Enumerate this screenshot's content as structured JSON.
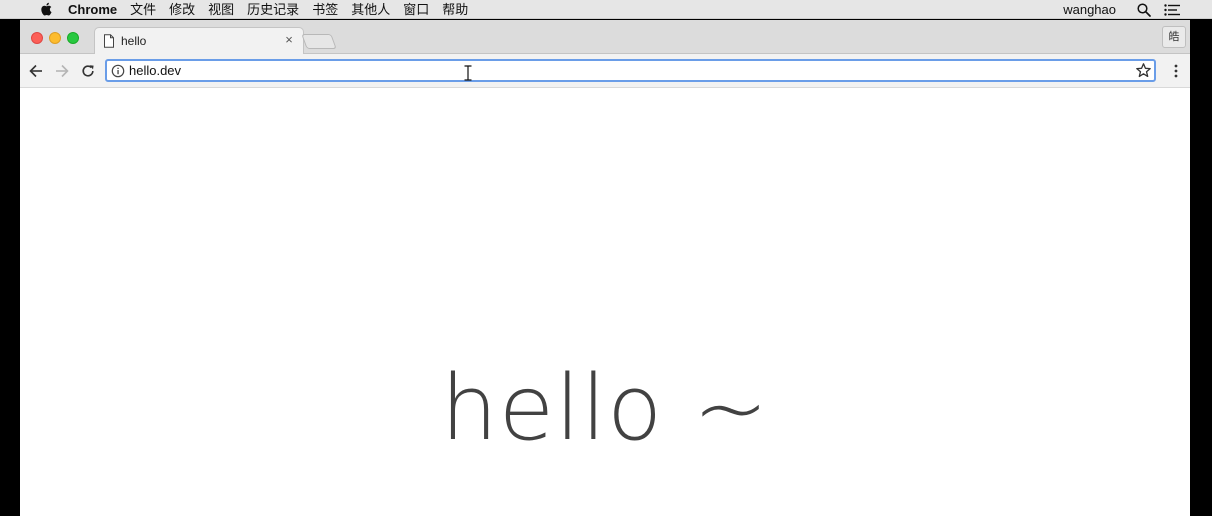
{
  "menubar": {
    "app_name": "Chrome",
    "items": [
      "文件",
      "修改",
      "视图",
      "历史记录",
      "书签",
      "其他人",
      "窗口",
      "帮助"
    ],
    "username": "wanghao",
    "icons": [
      "apple-icon",
      "spotlight-search-icon",
      "notification-list-icon"
    ]
  },
  "tab": {
    "title": "hello",
    "icon": "document-icon",
    "close_glyph": "×"
  },
  "toolbar": {
    "profile_label": "皓",
    "url": "hello.dev",
    "icons": [
      "back-arrow-icon",
      "forward-arrow-icon",
      "reload-icon",
      "info-icon",
      "star-icon",
      "kebab-menu-icon"
    ]
  },
  "page": {
    "heading": "hello ~"
  },
  "colors": {
    "close": "#fc5f57",
    "minimize": "#fdbc2e",
    "maximize": "#28c840",
    "omnibox_focus": "#6a9de8"
  }
}
